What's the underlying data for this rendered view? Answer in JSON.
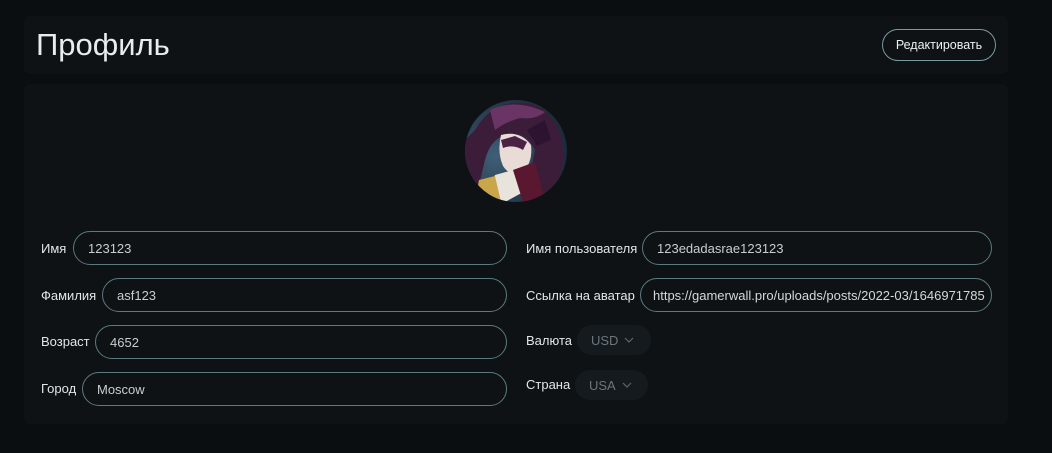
{
  "header": {
    "title": "Профиль",
    "edit_label": "Редактировать"
  },
  "profile": {
    "avatar_alt": "avatar",
    "fields": {
      "first_name": {
        "label": "Имя",
        "value": "123123"
      },
      "last_name": {
        "label": "Фамилия",
        "value": "asf123"
      },
      "age": {
        "label": "Возраст",
        "value": "4652"
      },
      "city": {
        "label": "Город",
        "value": "Moscow"
      },
      "username": {
        "label": "Имя пользователя",
        "value": "123edadasrae123123"
      },
      "avatar_url": {
        "label": "Ссылка на аватар",
        "value": "https://gamerwall.pro/uploads/posts/2022-03/1646971785"
      },
      "currency": {
        "label": "Валюта",
        "value": "USD"
      },
      "country": {
        "label": "Страна",
        "value": "USA"
      }
    }
  },
  "colors": {
    "background": "#0b0e11",
    "panel": "#0e1215",
    "input_border": "#5b7a80",
    "select_bg": "#151a1e"
  },
  "icons": {
    "select_chevron": "chevron-down-icon"
  }
}
